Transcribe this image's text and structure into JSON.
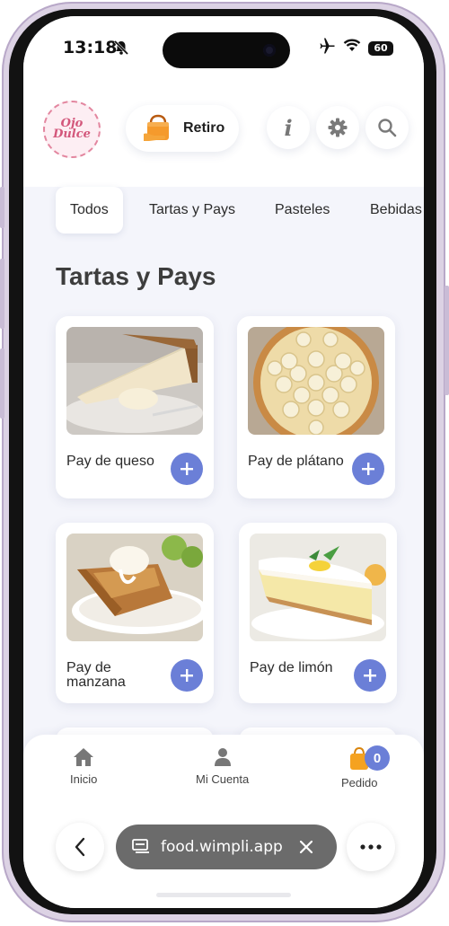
{
  "status_bar": {
    "time": "13:18",
    "battery": "60"
  },
  "header": {
    "logo_text_line1": "Ojo",
    "logo_text_line2": "Dulce",
    "pickup_label": "Retiro"
  },
  "tabs": [
    {
      "label": "Todos",
      "active": true
    },
    {
      "label": "Tartas y Pays",
      "active": false
    },
    {
      "label": "Pasteles",
      "active": false
    },
    {
      "label": "Bebidas",
      "active": false
    }
  ],
  "section": {
    "title": "Tartas y Pays"
  },
  "products": [
    {
      "name": "Pay de queso"
    },
    {
      "name": "Pay de plátano"
    },
    {
      "name": "Pay de manzana"
    },
    {
      "name": "Pay de limón"
    }
  ],
  "bottom_nav": {
    "items": [
      {
        "label": "Inicio"
      },
      {
        "label": "Mi Cuenta"
      },
      {
        "label": "Pedido"
      }
    ],
    "order_count": "0"
  },
  "browser": {
    "url": "food.wimpli.app"
  },
  "colors": {
    "accent": "#6b7fd7",
    "background": "#f4f5fb",
    "logo_pink": "#d3577b"
  },
  "icons": [
    "bell-slash-icon",
    "airplane-icon",
    "wifi-icon",
    "battery-icon",
    "shopping-bag-icon",
    "info-icon",
    "gear-icon",
    "search-icon",
    "plus-icon",
    "home-icon",
    "user-icon",
    "bag-icon",
    "tabs-icon",
    "close-icon",
    "chevron-left-icon",
    "more-icon"
  ]
}
